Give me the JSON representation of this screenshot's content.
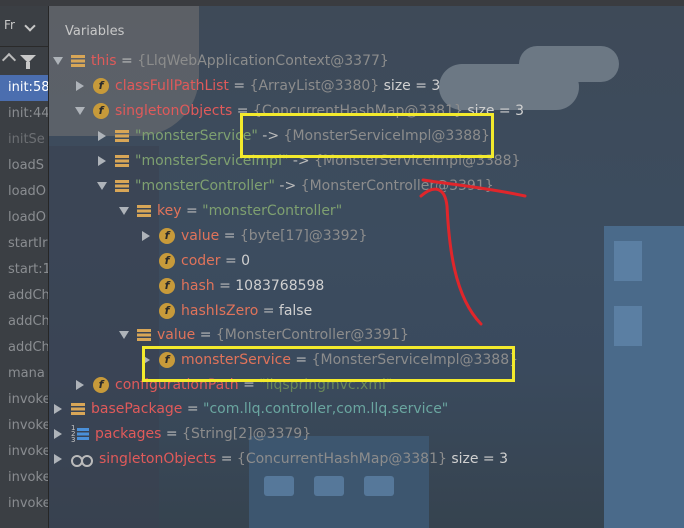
{
  "frames": {
    "label": "Fr",
    "items": [
      {
        "label": "init:58",
        "state": "selected"
      },
      {
        "label": "init:44",
        "state": "normal"
      },
      {
        "label": "initSe",
        "state": "dim"
      },
      {
        "label": "loadS",
        "state": "normal"
      },
      {
        "label": "loadO",
        "state": "normal"
      },
      {
        "label": "loadO",
        "state": "normal"
      },
      {
        "label": "startIr",
        "state": "normal"
      },
      {
        "label": "start:1",
        "state": "normal"
      },
      {
        "label": "addCh",
        "state": "normal"
      },
      {
        "label": "addCh",
        "state": "normal"
      },
      {
        "label": "addCh",
        "state": "normal"
      },
      {
        "label": "mana",
        "state": "normal"
      },
      {
        "label": "invoke",
        "state": "normal"
      },
      {
        "label": "invoke",
        "state": "normal"
      },
      {
        "label": "invoke",
        "state": "normal"
      },
      {
        "label": "invoke",
        "state": "normal"
      },
      {
        "label": "invoke",
        "state": "normal"
      }
    ]
  },
  "variables": {
    "title": "Variables",
    "rows": [
      {
        "name": "this",
        "eq": " = ",
        "value": "{LlqWebApplicationContext@3377}",
        "extra": ""
      },
      {
        "name": "classFullPathList",
        "eq": " = ",
        "value": "{ArrayList@3380}",
        "extra": "  size = 3"
      },
      {
        "name": "singletonObjects",
        "eq": " = ",
        "value": "{ConcurrentHashMap@3381}",
        "extra": "  size = 3"
      },
      {
        "name": "\"monsterService\"",
        "eq": " -> ",
        "value": "{MonsterServiceImpl@3388}",
        "extra": ""
      },
      {
        "name": "\"monsterServiceImpl\"",
        "eq": " -> ",
        "value": "{MonsterServiceImpl@3388}",
        "extra": ""
      },
      {
        "name": "\"monsterController\"",
        "eq": " -> ",
        "value": "{MonsterController@3391}",
        "extra": ""
      },
      {
        "name": "key",
        "eq": " = ",
        "value": "\"monsterController\"",
        "extra": ""
      },
      {
        "name": "value",
        "eq": " = ",
        "value": "{byte[17]@3392}",
        "extra": ""
      },
      {
        "name": "coder",
        "eq": " = ",
        "value": "0",
        "extra": ""
      },
      {
        "name": "hash",
        "eq": " = ",
        "value": "1083768598",
        "extra": ""
      },
      {
        "name": "hashIsZero",
        "eq": " = ",
        "value": "false",
        "extra": ""
      },
      {
        "name": "value",
        "eq": " = ",
        "value": "{MonsterController@3391}",
        "extra": ""
      },
      {
        "name": "monsterService",
        "eq": " = ",
        "value": "{MonsterServiceImpl@3388}",
        "extra": ""
      },
      {
        "name": "configurationPath",
        "eq": " = ",
        "value": "\"llqspringmvc.xml\"",
        "extra": ""
      },
      {
        "name": "basePackage",
        "eq": " = ",
        "value": "\"com.llq.controller,com.llq.service\"",
        "extra": ""
      },
      {
        "name": "packages",
        "eq": " = ",
        "value": "{String[2]@3379}",
        "extra": ""
      },
      {
        "name": "singletonObjects",
        "eq": " = ",
        "value": "{ConcurrentHashMap@3381}",
        "extra": "  size = 3"
      }
    ]
  },
  "colors": {
    "highlight_box": "#f3ea2c",
    "annotation_arrow": "#e0262b",
    "selected_frame": "#4b6eaf"
  }
}
